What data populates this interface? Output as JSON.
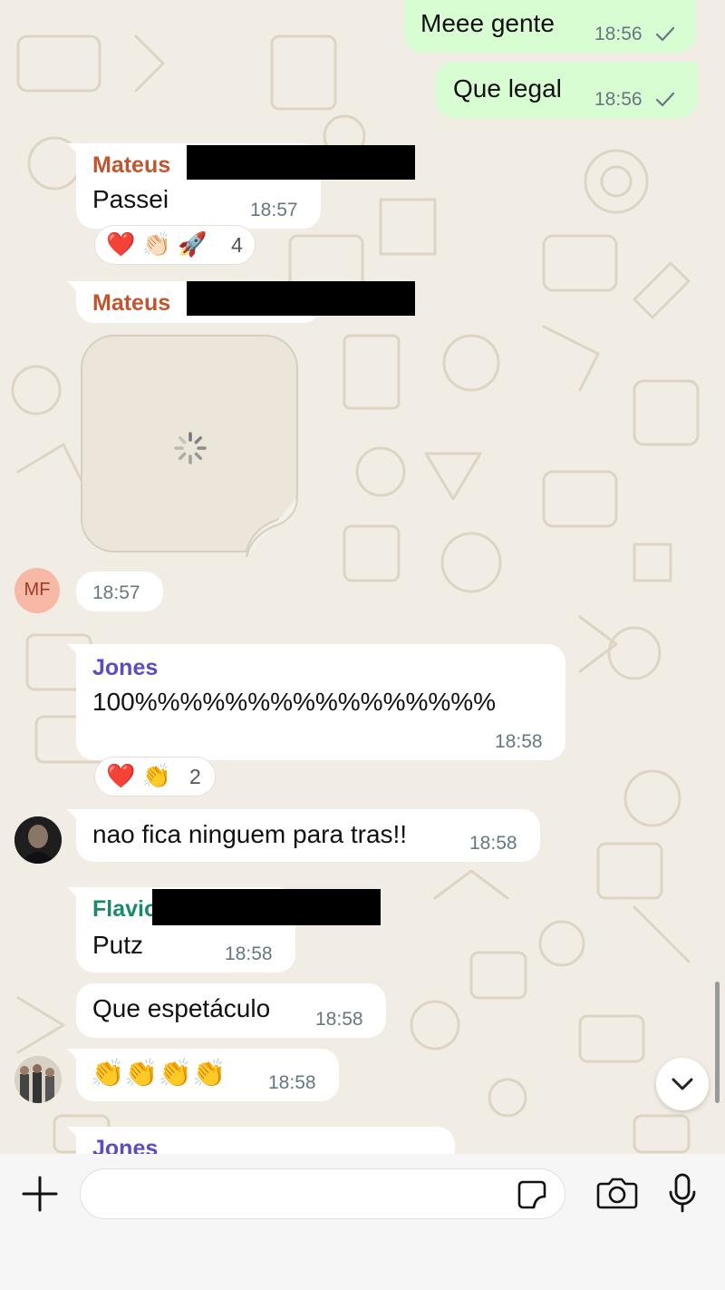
{
  "colors": {
    "wallpaper": "#f2ede4",
    "outgoing_bubble": "#d9fdd3",
    "incoming_bubble": "#ffffff",
    "sender_mateus": "#c0552f",
    "sender_jones": "#5b4bc4",
    "sender_flavio": "#1a8a6e",
    "timestamp": "#667781"
  },
  "messages": {
    "m1": {
      "text": "Meee gente",
      "time": "18:56",
      "status_icon": "check-icon"
    },
    "m2": {
      "text": "Que legal",
      "time": "18:56",
      "status_icon": "check-icon"
    },
    "m3": {
      "sender": "Mateus",
      "text": "Passei",
      "time": "18:57",
      "reactions": {
        "emojis": "❤️ 👏🏻 🚀",
        "count": "4"
      }
    },
    "m4": {
      "sender": "Mateus",
      "time": "18:57",
      "avatar_initials": "MF",
      "media": "sticker-loading"
    },
    "m5": {
      "sender": "Jones",
      "text": "100%%%%%%%%%%%%%%%%",
      "time": "18:58",
      "reactions": {
        "emojis": "❤️ 👏",
        "count": "2"
      }
    },
    "m6": {
      "text": "nao fica ninguem para tras!!",
      "time": "18:58"
    },
    "m7": {
      "sender": "Flavio",
      "text": "Putz",
      "time": "18:58"
    },
    "m8": {
      "text": "Que espetáculo",
      "time": "18:58"
    },
    "m9": {
      "text": "👏👏👏👏",
      "time": "18:58"
    },
    "m10": {
      "sender": "Jones"
    }
  },
  "composer": {
    "placeholder": "",
    "icons": [
      "plus-icon",
      "sticker-icon",
      "camera-icon",
      "microphone-icon"
    ]
  },
  "scroll_down_icon": "chevron-down-icon"
}
